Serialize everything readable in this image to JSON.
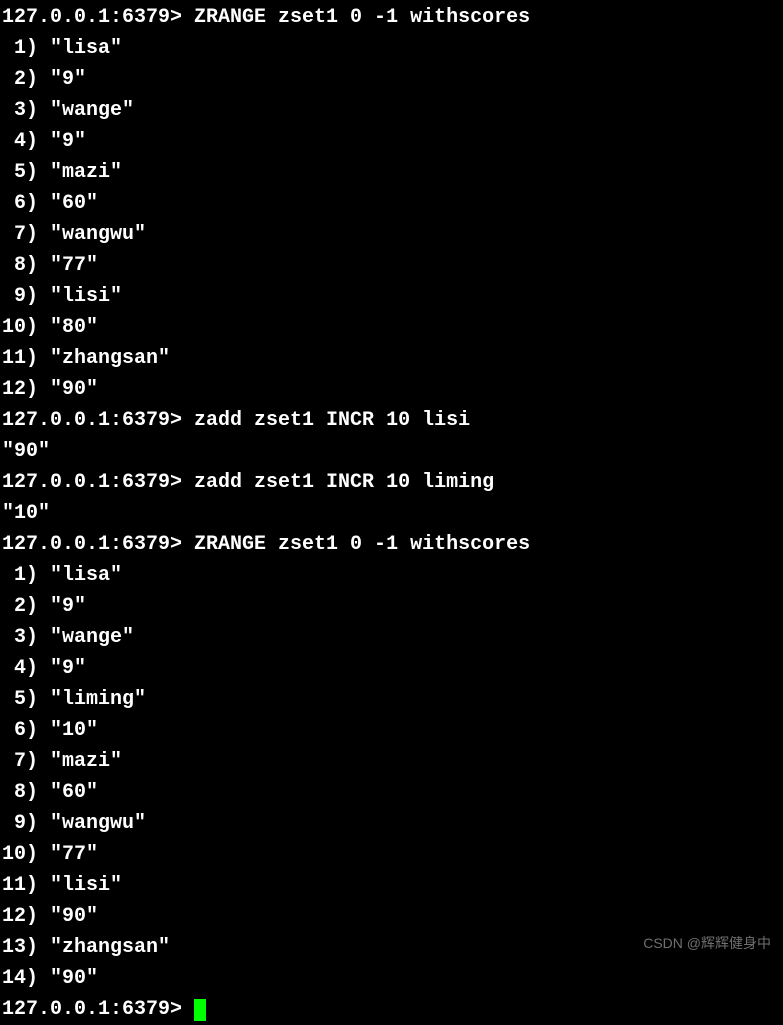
{
  "terminal": {
    "lines": [
      {
        "type": "cmd",
        "prompt": "127.0.0.1:6379>",
        "command": "ZRANGE zset1 0 -1 withscores"
      },
      {
        "type": "result",
        "index": " 1)",
        "value": "\"lisa\""
      },
      {
        "type": "result",
        "index": " 2)",
        "value": "\"9\""
      },
      {
        "type": "result",
        "index": " 3)",
        "value": "\"wange\""
      },
      {
        "type": "result",
        "index": " 4)",
        "value": "\"9\""
      },
      {
        "type": "result",
        "index": " 5)",
        "value": "\"mazi\""
      },
      {
        "type": "result",
        "index": " 6)",
        "value": "\"60\""
      },
      {
        "type": "result",
        "index": " 7)",
        "value": "\"wangwu\""
      },
      {
        "type": "result",
        "index": " 8)",
        "value": "\"77\""
      },
      {
        "type": "result",
        "index": " 9)",
        "value": "\"lisi\""
      },
      {
        "type": "result",
        "index": "10)",
        "value": "\"80\""
      },
      {
        "type": "result",
        "index": "11)",
        "value": "\"zhangsan\""
      },
      {
        "type": "result",
        "index": "12)",
        "value": "\"90\""
      },
      {
        "type": "cmd",
        "prompt": "127.0.0.1:6379>",
        "command": "zadd zset1 INCR 10 lisi"
      },
      {
        "type": "output",
        "text": "\"90\""
      },
      {
        "type": "cmd",
        "prompt": "127.0.0.1:6379>",
        "command": "zadd zset1 INCR 10 liming"
      },
      {
        "type": "output",
        "text": "\"10\""
      },
      {
        "type": "cmd",
        "prompt": "127.0.0.1:6379>",
        "command": "ZRANGE zset1 0 -1 withscores"
      },
      {
        "type": "result",
        "index": " 1)",
        "value": "\"lisa\""
      },
      {
        "type": "result",
        "index": " 2)",
        "value": "\"9\""
      },
      {
        "type": "result",
        "index": " 3)",
        "value": "\"wange\""
      },
      {
        "type": "result",
        "index": " 4)",
        "value": "\"9\""
      },
      {
        "type": "result",
        "index": " 5)",
        "value": "\"liming\""
      },
      {
        "type": "result",
        "index": " 6)",
        "value": "\"10\""
      },
      {
        "type": "result",
        "index": " 7)",
        "value": "\"mazi\""
      },
      {
        "type": "result",
        "index": " 8)",
        "value": "\"60\""
      },
      {
        "type": "result",
        "index": " 9)",
        "value": "\"wangwu\""
      },
      {
        "type": "result",
        "index": "10)",
        "value": "\"77\""
      },
      {
        "type": "result",
        "index": "11)",
        "value": "\"lisi\""
      },
      {
        "type": "result",
        "index": "12)",
        "value": "\"90\""
      },
      {
        "type": "result",
        "index": "13)",
        "value": "\"zhangsan\""
      },
      {
        "type": "result",
        "index": "14)",
        "value": "\"90\""
      },
      {
        "type": "cursor",
        "prompt": "127.0.0.1:6379>"
      }
    ]
  },
  "watermark": "CSDN @辉辉健身中"
}
